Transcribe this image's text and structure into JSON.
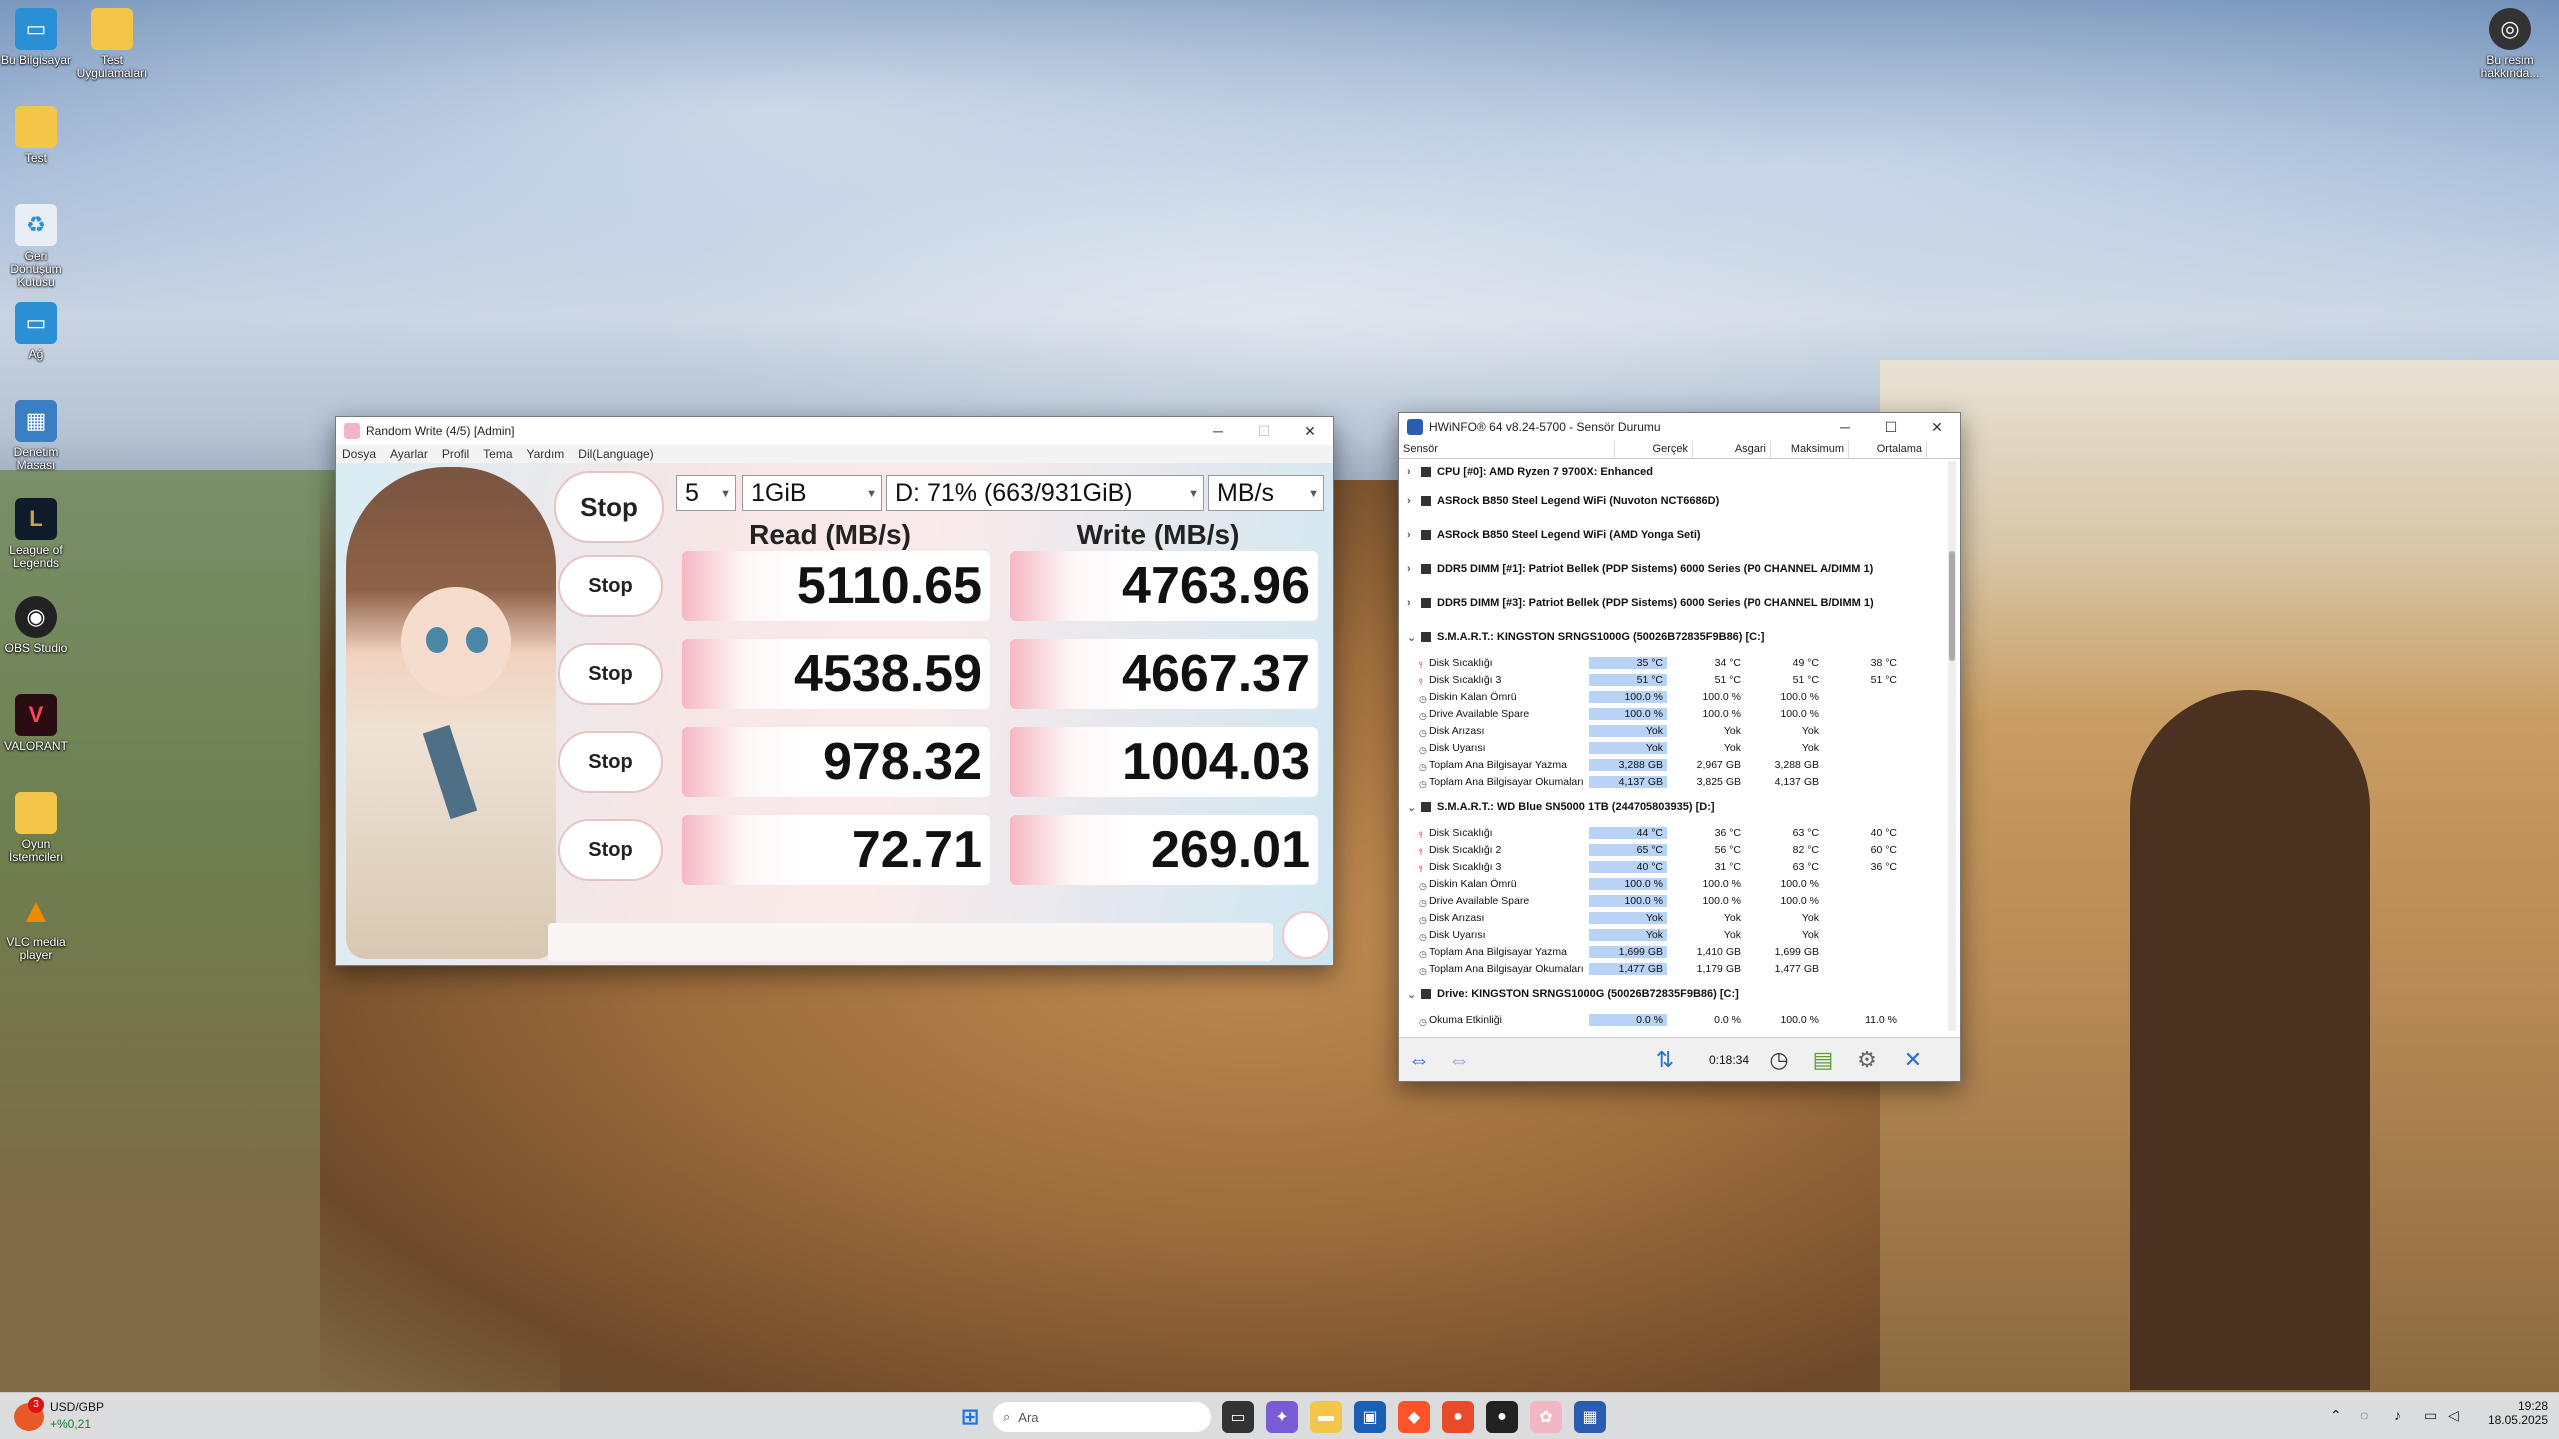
{
  "desktop": {
    "icons": [
      {
        "label": "Bu Bilgisayar",
        "icon": "monitor-icon"
      },
      {
        "label": "Test Uygulamaları",
        "icon": "folder-icon"
      },
      {
        "label": "Test",
        "icon": "folder-icon"
      },
      {
        "label": "Geri Dönüşüm Kutusu",
        "icon": "recycle-bin-icon"
      },
      {
        "label": "Ağ",
        "icon": "network-icon"
      },
      {
        "label": "Denetim Masası",
        "icon": "control-panel-icon"
      },
      {
        "label": "League of Legends",
        "icon": "lol-icon"
      },
      {
        "label": "OBS Studio",
        "icon": "obs-icon"
      },
      {
        "label": "VALORANT",
        "icon": "valorant-icon"
      },
      {
        "label": "Oyun İstemcileri",
        "icon": "folder-icon"
      },
      {
        "label": "VLC media player",
        "icon": "vlc-icon"
      }
    ],
    "top_right_label": "Bu resim hakkında..."
  },
  "cdm": {
    "title": "Random Write (4/5) [Admin]",
    "menu": [
      "Dosya",
      "Ayarlar",
      "Profil",
      "Tema",
      "Yardım",
      "Dil(Language)"
    ],
    "count": "5",
    "size": "1GiB",
    "drive": "D: 71% (663/931GiB)",
    "unit": "MB/s",
    "read_header": "Read (MB/s)",
    "write_header": "Write (MB/s)",
    "stop_all": "Stop",
    "rows": [
      {
        "stop": "Stop",
        "read": "5110.65",
        "write": "4763.96"
      },
      {
        "stop": "Stop",
        "read": "4538.59",
        "write": "4667.37"
      },
      {
        "stop": "Stop",
        "read": "978.32",
        "write": "1004.03"
      },
      {
        "stop": "Stop",
        "read": "72.71",
        "write": "269.01"
      }
    ]
  },
  "hwinfo": {
    "title": "HWiNFO® 64 v8.24-5700 - Sensör Durumu",
    "columns": [
      "Sensör",
      "Gerçek",
      "Asgari",
      "Maksimum",
      "Ortalama"
    ],
    "groups_top": [
      "CPU [#0]: AMD Ryzen 7 9700X: Enhanced",
      "ASRock B850 Steel Legend WiFi (Nuvoton NCT6686D)",
      "ASRock B850 Steel Legend WiFi (AMD Yonga Seti)",
      "DDR5 DIMM [#1]: Patriot Bellek (PDP Sistems) 6000 Series (P0 CHANNEL A/DIMM 1)",
      "DDR5 DIMM [#3]: Patriot Bellek (PDP Sistems) 6000 Series (P0 CHANNEL B/DIMM 1)"
    ],
    "smart1": {
      "title": "S.M.A.R.T.: KINGSTON SRNGS1000G (50026B72835F9B86) [C:]",
      "rows": [
        {
          "name": "Disk Sıcaklığı",
          "cur": "35 °C",
          "min": "34 °C",
          "max": "49 °C",
          "avg": "38 °C"
        },
        {
          "name": "Disk Sıcaklığı 3",
          "cur": "51 °C",
          "min": "51 °C",
          "max": "51 °C",
          "avg": "51 °C"
        },
        {
          "name": "Diskin Kalan Ömrü",
          "cur": "100.0 %",
          "min": "100.0 %",
          "max": "100.0 %",
          "avg": ""
        },
        {
          "name": "Drive Available Spare",
          "cur": "100.0 %",
          "min": "100.0 %",
          "max": "100.0 %",
          "avg": ""
        },
        {
          "name": "Disk Arızası",
          "cur": "Yok",
          "min": "Yok",
          "max": "Yok",
          "avg": ""
        },
        {
          "name": "Disk Uyarısı",
          "cur": "Yok",
          "min": "Yok",
          "max": "Yok",
          "avg": ""
        },
        {
          "name": "Toplam Ana Bilgisayar Yazma",
          "cur": "3,288 GB",
          "min": "2,967 GB",
          "max": "3,288 GB",
          "avg": ""
        },
        {
          "name": "Toplam Ana Bilgisayar Okumaları",
          "cur": "4,137 GB",
          "min": "3,825 GB",
          "max": "4,137 GB",
          "avg": ""
        }
      ]
    },
    "smart2": {
      "title": "S.M.A.R.T.: WD Blue SN5000 1TB (244705803935) [D:]",
      "rows": [
        {
          "name": "Disk Sıcaklığı",
          "cur": "44 °C",
          "min": "36 °C",
          "max": "63 °C",
          "avg": "40 °C"
        },
        {
          "name": "Disk Sıcaklığı 2",
          "cur": "65 °C",
          "min": "56 °C",
          "max": "82 °C",
          "avg": "60 °C"
        },
        {
          "name": "Disk Sıcaklığı 3",
          "cur": "40 °C",
          "min": "31 °C",
          "max": "63 °C",
          "avg": "36 °C"
        },
        {
          "name": "Diskin Kalan Ömrü",
          "cur": "100.0 %",
          "min": "100.0 %",
          "max": "100.0 %",
          "avg": ""
        },
        {
          "name": "Drive Available Spare",
          "cur": "100.0 %",
          "min": "100.0 %",
          "max": "100.0 %",
          "avg": ""
        },
        {
          "name": "Disk Arızası",
          "cur": "Yok",
          "min": "Yok",
          "max": "Yok",
          "avg": ""
        },
        {
          "name": "Disk Uyarısı",
          "cur": "Yok",
          "min": "Yok",
          "max": "Yok",
          "avg": ""
        },
        {
          "name": "Toplam Ana Bilgisayar Yazma",
          "cur": "1,699 GB",
          "min": "1,410 GB",
          "max": "1,699 GB",
          "avg": ""
        },
        {
          "name": "Toplam Ana Bilgisayar Okumaları",
          "cur": "1,477 GB",
          "min": "1,179 GB",
          "max": "1,477 GB",
          "avg": ""
        }
      ]
    },
    "drive": {
      "title": "Drive: KINGSTON SRNGS1000G (50026B72835F9B86) [C:]",
      "rows": [
        {
          "name": "Okuma Etkinliği",
          "cur": "0.0 %",
          "min": "0.0 %",
          "max": "100.0 %",
          "avg": "11.0 %"
        }
      ]
    },
    "timer": "0:18:34"
  },
  "taskbar": {
    "widget_title": "USD/GBP",
    "widget_value": "+%0,21",
    "widget_badge": "3",
    "search_placeholder": "Ara",
    "time": "19:28",
    "date": "18.05.2025"
  }
}
